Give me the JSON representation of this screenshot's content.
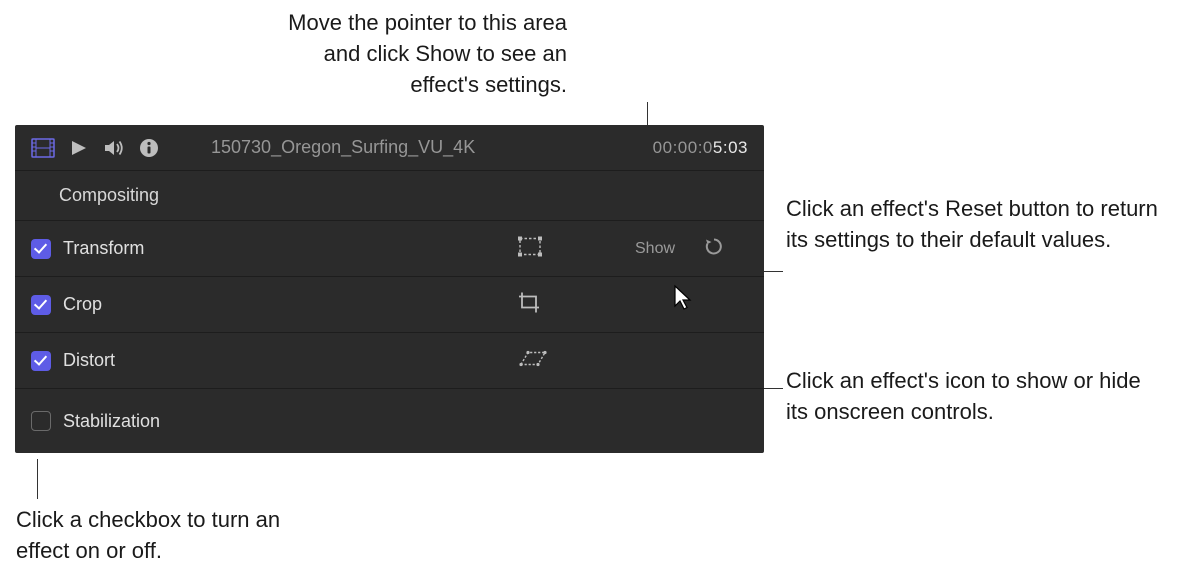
{
  "annotations": {
    "top": "Move the pointer to this area and click Show to see an effect's settings.",
    "reset": "Click an effect's Reset button to return its settings to their default values.",
    "icon": "Click an effect's icon to show or hide its onscreen controls.",
    "checkbox": "Click a checkbox to turn an effect on or off."
  },
  "header": {
    "clip_name": "150730_Oregon_Surfing_VU_4K",
    "timecode_dim": "00:00:0",
    "timecode_bright": "5:03"
  },
  "section": {
    "title": "Compositing"
  },
  "rows": {
    "transform": {
      "label": "Transform",
      "show": "Show"
    },
    "crop": {
      "label": "Crop"
    },
    "distort": {
      "label": "Distort"
    },
    "stabilization": {
      "label": "Stabilization"
    }
  }
}
